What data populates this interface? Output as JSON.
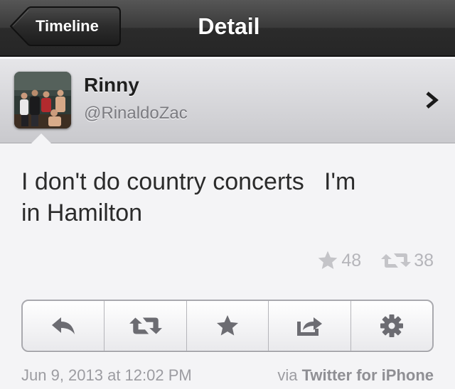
{
  "navbar": {
    "back_label": "Timeline",
    "title": "Detail"
  },
  "profile": {
    "display_name": "Rinny",
    "handle": "@RinaldoZac"
  },
  "tweet": {
    "text": "I don't do country concerts   I'm\nin Hamilton",
    "favorites": "48",
    "retweets": "38",
    "timestamp": "Jun 9, 2013 at 12:02 PM",
    "via_prefix": "via ",
    "client": "Twitter for iPhone"
  },
  "actions": [
    {
      "icon": "reply-icon"
    },
    {
      "icon": "retweet-icon"
    },
    {
      "icon": "star-icon"
    },
    {
      "icon": "share-icon"
    },
    {
      "icon": "gear-icon"
    }
  ],
  "colors": {
    "navbar": "#2b2b2b",
    "icon_gray": "#6c6c72",
    "stat_gray": "#b5b5ba"
  }
}
